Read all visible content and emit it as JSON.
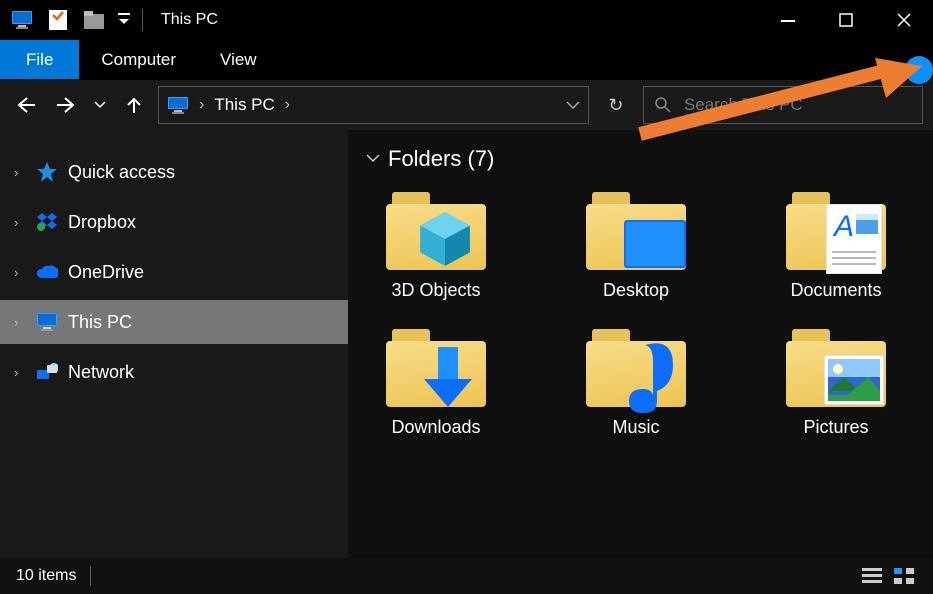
{
  "window": {
    "title": "This PC"
  },
  "ribbon": {
    "file": "File",
    "tabs": [
      "Computer",
      "View"
    ]
  },
  "address": {
    "location": "This PC"
  },
  "search": {
    "placeholder": "Search This PC"
  },
  "sidebar": {
    "items": [
      {
        "label": "Quick access",
        "icon": "star"
      },
      {
        "label": "Dropbox",
        "icon": "dropbox"
      },
      {
        "label": "OneDrive",
        "icon": "onedrive"
      },
      {
        "label": "This PC",
        "icon": "pc",
        "selected": true
      },
      {
        "label": "Network",
        "icon": "network"
      }
    ]
  },
  "section": {
    "title": "Folders (7)"
  },
  "folders": [
    {
      "label": "3D Objects",
      "icon": "cube"
    },
    {
      "label": "Desktop",
      "icon": "desktop"
    },
    {
      "label": "Documents",
      "icon": "document"
    },
    {
      "label": "Downloads",
      "icon": "download"
    },
    {
      "label": "Music",
      "icon": "music"
    },
    {
      "label": "Pictures",
      "icon": "picture"
    }
  ],
  "status": {
    "count": "10 items"
  }
}
